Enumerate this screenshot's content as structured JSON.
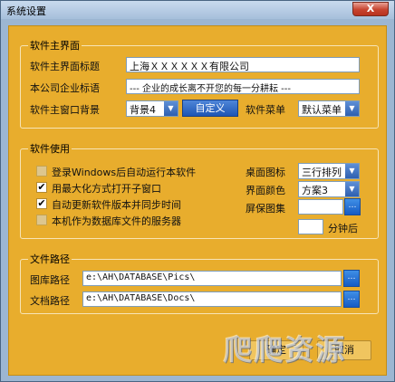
{
  "window": {
    "title": "系统设置",
    "close_glyph": "X"
  },
  "colors": {
    "client_bg": "#e8ad2d",
    "frame_bg": "#9cb6d2",
    "accent_blue": "#2e5fb0"
  },
  "main_ui": {
    "group_title": "软件主界面",
    "title_label": "软件主界面标题",
    "title_value": "上海ＸＸＸＸＸＸ有限公司",
    "slogan_label": "本公司企业标语",
    "slogan_value": "---  企业的成长离不开您的每一分耕耘  ---",
    "bg_label": "软件主窗口背景",
    "bg_selected": "背景4",
    "custom_button": "自定义",
    "menu_label": "软件菜单",
    "menu_selected": "默认菜单"
  },
  "usage": {
    "group_title": "软件使用",
    "options": [
      {
        "label": "登录Windows后自动运行本软件",
        "checked": false,
        "enabled": false
      },
      {
        "label": "用最大化方式打开子窗口",
        "checked": true,
        "enabled": true
      },
      {
        "label": "自动更新软件版本并同步时间",
        "checked": true,
        "enabled": true
      },
      {
        "label": "本机作为数据库文件的服务器",
        "checked": false,
        "enabled": false
      }
    ],
    "desktop_icon_label": "桌面图标",
    "desktop_icon_selected": "三行排列",
    "color_label": "界面颜色",
    "color_selected": "方案3",
    "screensaver_label": "屏保图集",
    "screensaver_value": "",
    "minutes_value": "",
    "minutes_suffix": "分钟后"
  },
  "paths": {
    "group_title": "文件路径",
    "pics_label": "图库路径",
    "pics_value": "e:\\AH\\DATABASE\\Pics\\",
    "docs_label": "文档路径",
    "docs_value": "e:\\AH\\DATABASE\\Docs\\"
  },
  "footer": {
    "ok_label": "确定",
    "cancel_label": "取消",
    "watermark": "爬爬资源"
  }
}
